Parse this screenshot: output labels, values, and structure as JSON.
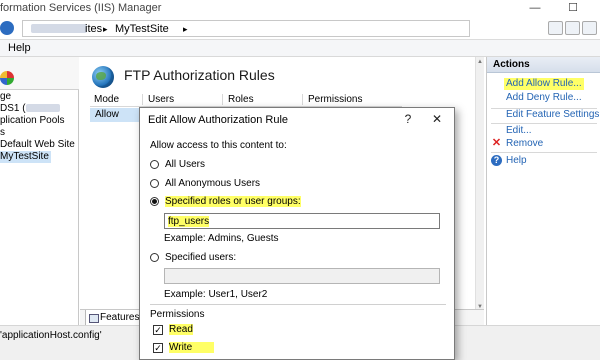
{
  "window": {
    "title": "formation Services (IIS) Manager",
    "minimize_icon": "minimize-icon",
    "maximize_icon": "maximize-icon"
  },
  "address_bar": {
    "crumbs": [
      "ites",
      "MyTestSite"
    ],
    "separator": "▸"
  },
  "menu": {
    "items": [
      "Help"
    ]
  },
  "connections": {
    "tree": [
      {
        "label": "ge"
      },
      {
        "label": "DS1 (",
        "blurred_suffix": true,
        "tail": ")"
      },
      {
        "label": "plication Pools"
      },
      {
        "label": "s"
      },
      {
        "label": "Default Web Site"
      },
      {
        "label": "MyTestSite",
        "selected": true
      }
    ]
  },
  "main": {
    "heading": "FTP Authorization Rules",
    "columns": [
      "Mode",
      "Users",
      "Roles",
      "Permissions"
    ],
    "rows": [
      {
        "mode": "Allow"
      }
    ],
    "bottom_tab": "Features Vie"
  },
  "status_bar": {
    "text": "'applicationHost.config'"
  },
  "actions": {
    "header": "Actions",
    "items": [
      {
        "label": "Add Allow Rule...",
        "highlighted": true
      },
      {
        "label": "Add Deny Rule..."
      },
      {
        "label": "Edit Feature Settings..."
      },
      {
        "label": "Edit..."
      },
      {
        "label": "Remove",
        "icon": "remove-icon"
      },
      {
        "label": "Help",
        "icon": "help-icon"
      }
    ]
  },
  "dialog": {
    "title": "Edit Allow Authorization Rule",
    "help_button": "?",
    "close_button": "✕",
    "prompt": "Allow access to this content to:",
    "options": {
      "all_users": "All Users",
      "all_anonymous": "All Anonymous Users",
      "specified_roles": "Specified roles or user groups:",
      "specified_users": "Specified users:"
    },
    "selected_option": "specified_roles",
    "roles_value": "ftp_users",
    "roles_example": "Example: Admins, Guests",
    "users_value": "",
    "users_example": "Example: User1, User2",
    "permissions_label": "Permissions",
    "permissions": {
      "read": {
        "label": "Read",
        "checked": true
      },
      "write": {
        "label": "Write",
        "checked": true
      }
    },
    "check_glyph": "✓"
  },
  "colors": {
    "highlight": "#ffff66",
    "link": "#2364b4",
    "selection": "#cde3f7"
  }
}
